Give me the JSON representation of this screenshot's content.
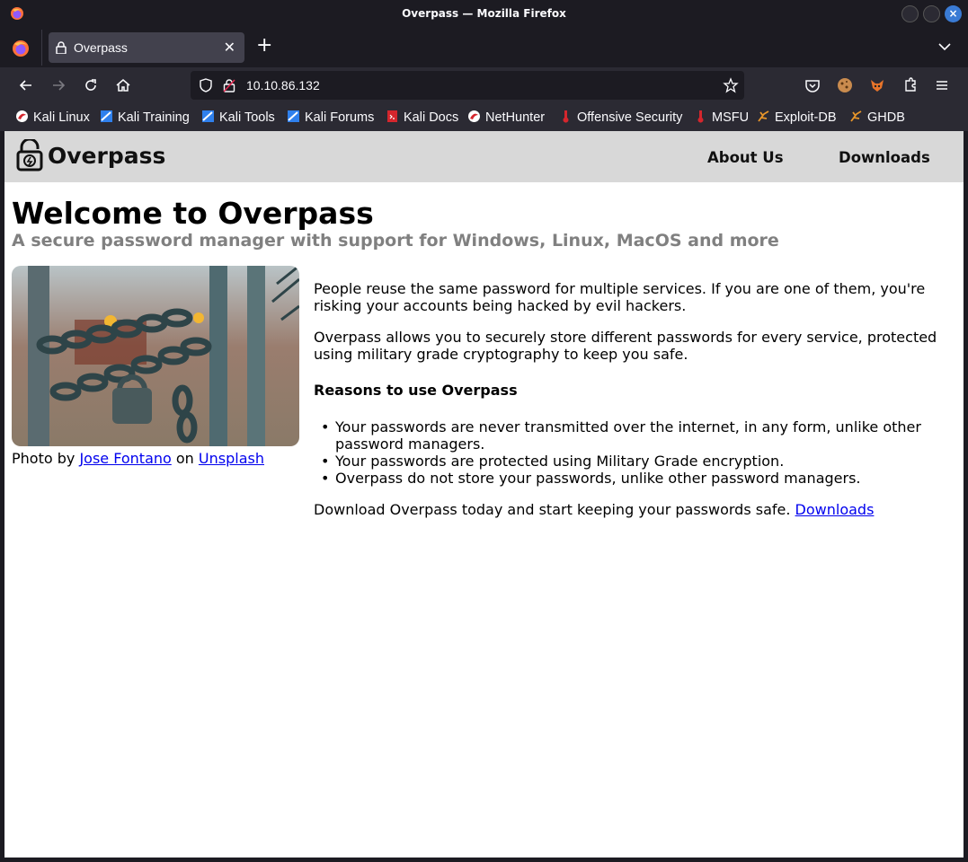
{
  "window": {
    "title": "Overpass — Mozilla Firefox"
  },
  "tab": {
    "title": "Overpass"
  },
  "urlbar": {
    "url": "10.10.86.132"
  },
  "bookmarks": [
    {
      "label": "Kali Linux",
      "icon": "kali-dragon-icon"
    },
    {
      "label": "Kali Training",
      "icon": "kali-training-icon"
    },
    {
      "label": "Kali Tools",
      "icon": "kali-tools-icon"
    },
    {
      "label": "Kali Forums",
      "icon": "kali-forums-icon"
    },
    {
      "label": "Kali Docs",
      "icon": "kali-docs-icon"
    },
    {
      "label": "NetHunter",
      "icon": "nethunter-icon"
    },
    {
      "label": "Offensive Security",
      "icon": "offsec-icon"
    },
    {
      "label": "MSFU",
      "icon": "msfu-icon"
    },
    {
      "label": "Exploit-DB",
      "icon": "exploit-db-icon"
    },
    {
      "label": "GHDB",
      "icon": "ghdb-icon"
    }
  ],
  "site": {
    "brand": "Overpass",
    "nav": {
      "about": "About Us",
      "downloads": "Downloads"
    },
    "heading": "Welcome to Overpass",
    "subheading": "A secure password manager with support for Windows, Linux, MacOS and more",
    "caption": {
      "prefix": "Photo by",
      "author": "Jose Fontano",
      "middle": "on",
      "source": "Unsplash"
    },
    "para1": "People reuse the same password for multiple services. If you are one of them, you're risking your accounts being hacked by evil hackers.",
    "para2": "Overpass allows you to securely store different passwords for every service, protected using military grade cryptography to keep you safe.",
    "reasons_title": "Reasons to use Overpass",
    "reasons": [
      "Your passwords are never transmitted over the internet, in any form, unlike other password managers.",
      "Your passwords are protected using Military Grade encryption.",
      "Overpass do not store your passwords, unlike other password managers."
    ],
    "download_text": "Download Overpass today and start keeping your passwords safe.",
    "download_link": "Downloads"
  },
  "colors": {
    "header_bg": "#d8d8d8",
    "subtitle": "#808080",
    "link": "#0000ee",
    "chrome_dark": "#1c1b22",
    "toolbar": "#2b2a33"
  }
}
